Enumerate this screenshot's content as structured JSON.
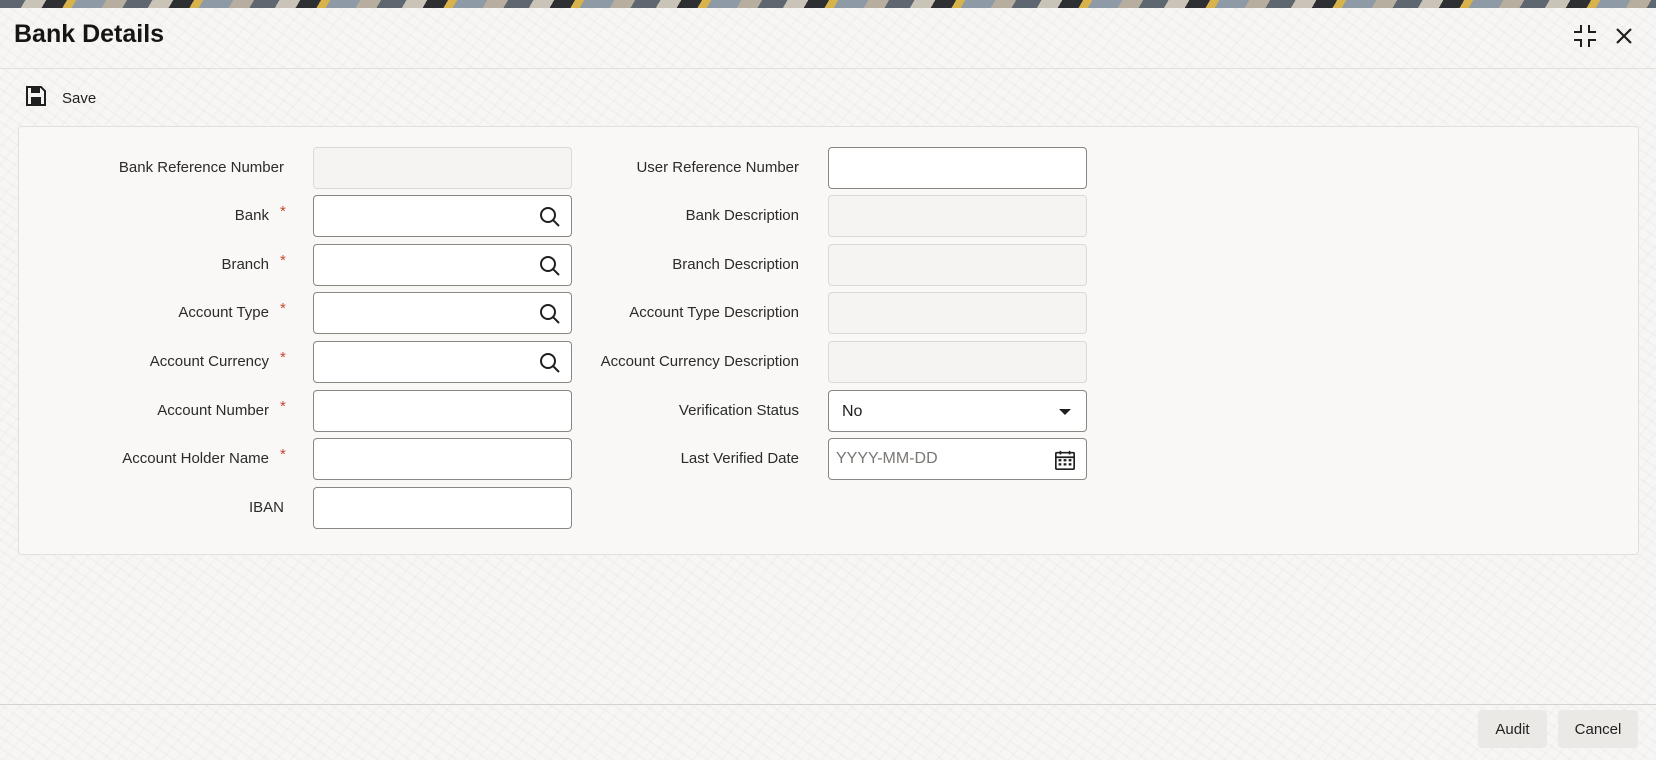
{
  "window": {
    "title": "Bank Details",
    "icons": {
      "restore": "minimize-window-icon",
      "close": "close-icon"
    }
  },
  "toolbar": {
    "save_label": "Save",
    "save_icon": "save-icon"
  },
  "form": {
    "bank_reference_number": {
      "label": "Bank Reference Number",
      "value": "",
      "required": false,
      "readonly": true
    },
    "bank": {
      "label": "Bank",
      "value": "",
      "required": true,
      "icon": "search-icon"
    },
    "branch": {
      "label": "Branch",
      "value": "",
      "required": true,
      "icon": "search-icon"
    },
    "account_type": {
      "label": "Account Type",
      "value": "",
      "required": true,
      "icon": "search-icon"
    },
    "account_currency": {
      "label": "Account Currency",
      "value": "",
      "required": true,
      "icon": "search-icon"
    },
    "account_number": {
      "label": "Account Number",
      "value": "",
      "required": true
    },
    "account_holder_name": {
      "label": "Account Holder Name",
      "value": "",
      "required": true
    },
    "iban": {
      "label": "IBAN",
      "value": "",
      "required": false
    },
    "user_reference_number": {
      "label": "User Reference Number",
      "value": ""
    },
    "bank_description": {
      "label": "Bank Description",
      "value": "",
      "readonly": true
    },
    "branch_description": {
      "label": "Branch Description",
      "value": "",
      "readonly": true
    },
    "account_type_description": {
      "label": "Account Type Description",
      "value": "",
      "readonly": true
    },
    "account_currency_description": {
      "label": "Account Currency Description",
      "value": "",
      "readonly": true
    },
    "verification_status": {
      "label": "Verification Status",
      "value": "No",
      "icon": "caret-down-icon"
    },
    "last_verified_date": {
      "label": "Last Verified Date",
      "value": "",
      "placeholder": "YYYY-MM-DD",
      "icon": "calendar-icon"
    },
    "required_marker": "*"
  },
  "footer": {
    "audit_label": "Audit",
    "cancel_label": "Cancel"
  },
  "colors": {
    "required": "#c74634",
    "panel": "#f9f8f6",
    "readonly_field": "#f5f4f2"
  }
}
